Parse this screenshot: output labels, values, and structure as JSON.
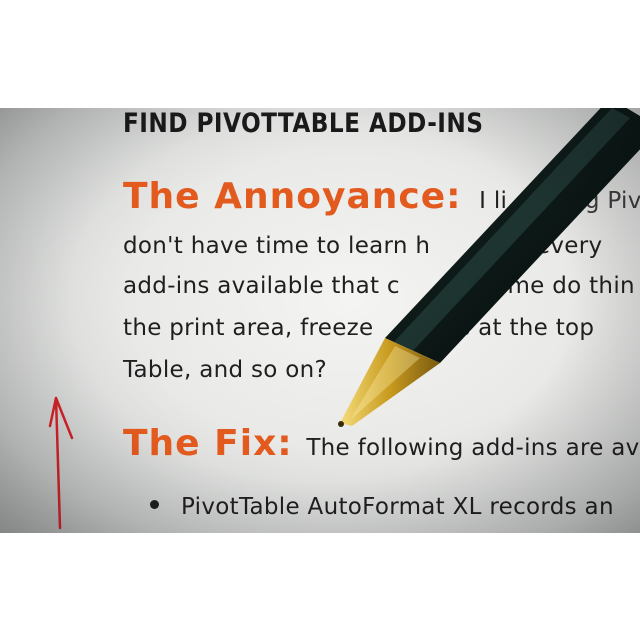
{
  "page": {
    "heading": "FIND PIVOTTABLE ADD-INS",
    "annoyance_label": "The Annoyance:",
    "annoyance_line1_rest": "I li",
    "annoyance_line1_tail": "g Pivo",
    "annoyance_line2": "don't have time to learn h",
    "annoyance_line2_tail": "o every",
    "annoyance_line3": "add-ins available that c",
    "annoyance_line3_tail": "me do thin",
    "annoyance_line4": "the print area, freeze",
    "annoyance_line4_tail": "ws at the top",
    "annoyance_line5": "Table, and so on?",
    "fix_label": "The Fix:",
    "fix_text": "The following add-ins are ava",
    "bullet1": "PivotTable AutoFormat XL records an"
  },
  "colors": {
    "accent_orange": "#e35a1e",
    "text": "#1f1f1f",
    "pen_body": "#0f1e1c",
    "pen_tip": "#c9a227",
    "margin_mark": "#d2232a"
  }
}
